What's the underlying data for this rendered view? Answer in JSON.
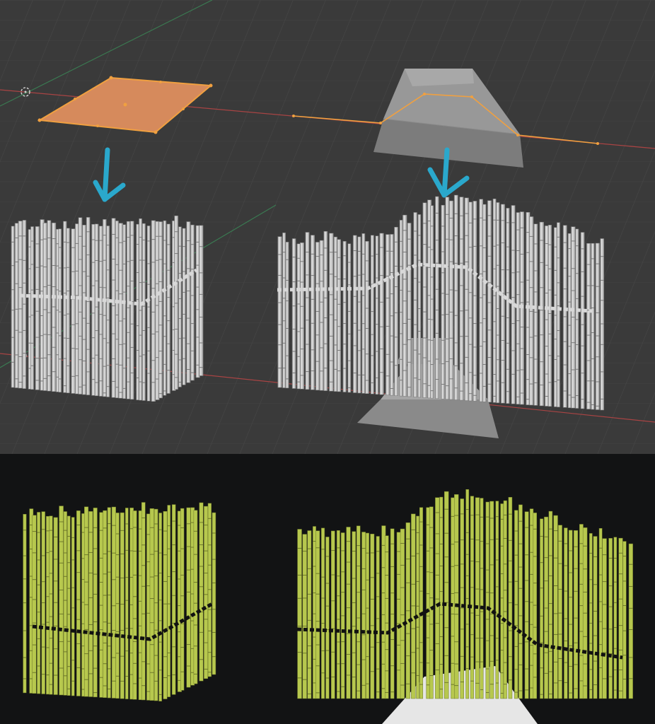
{
  "viewport": {
    "background_color": "#3a3a3a",
    "grid_color": "#464646",
    "x_axis_color": "#b44444",
    "y_axis_color": "#3a8a5a",
    "selection_color": "#f0a040",
    "arrow_color": "#2aa8cc",
    "bamboo_color": "#cfcfcf",
    "objects": [
      {
        "name": "plane",
        "type": "selected-plane"
      },
      {
        "name": "curve",
        "type": "edge-path"
      },
      {
        "name": "hill-mesh",
        "type": "frustum"
      }
    ],
    "arrows": [
      {
        "icon": "arrow-down-icon"
      },
      {
        "icon": "arrow-down-icon"
      }
    ]
  },
  "render": {
    "background_color": "#121314",
    "bamboo_color": "#b7c84e",
    "bamboo_light": "#e2ea8a",
    "rope_color": "#111111",
    "ground_color": "#e6e6e6"
  }
}
